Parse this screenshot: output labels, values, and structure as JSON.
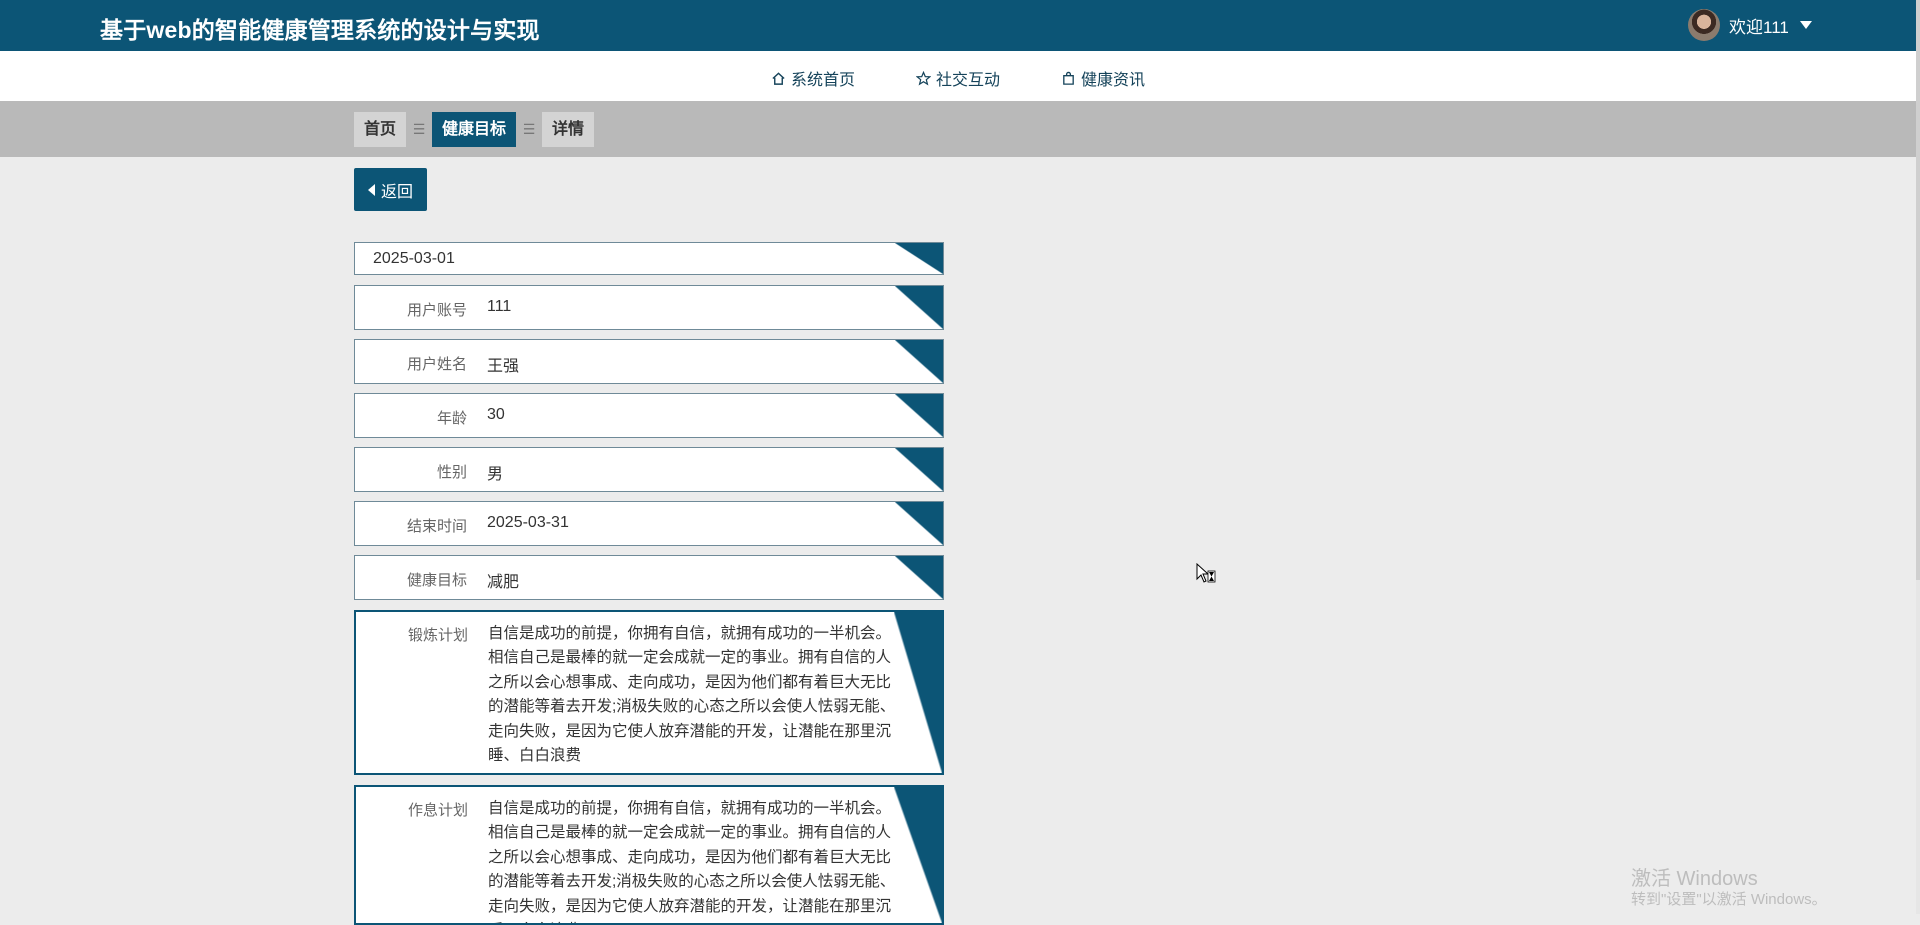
{
  "header": {
    "title": "基于web的智能健康管理系统的设计与实现",
    "user_greeting": "欢迎111"
  },
  "nav": {
    "items": [
      {
        "label": "系统首页",
        "icon": "home-icon"
      },
      {
        "label": "社交互动",
        "icon": "star-icon"
      },
      {
        "label": "健康资讯",
        "icon": "bag-icon"
      }
    ]
  },
  "breadcrumb": {
    "items": [
      "首页",
      "健康目标",
      "详情"
    ],
    "separator": "☰",
    "active_index": 1
  },
  "back_button": {
    "label": "返回"
  },
  "detail": {
    "date": "2025-03-01",
    "fields": [
      {
        "label": "用户账号",
        "value": "111"
      },
      {
        "label": "用户姓名",
        "value": "王强"
      },
      {
        "label": "年龄",
        "value": "30"
      },
      {
        "label": "性别",
        "value": "男"
      },
      {
        "label": "结束时间",
        "value": "2025-03-31"
      },
      {
        "label": "健康目标",
        "value": "减肥"
      }
    ],
    "exercise_plan": {
      "label": "锻炼计划",
      "value": "自信是成功的前提，你拥有自信，就拥有成功的一半机会。相信自己是最棒的就一定会成就一定的事业。拥有自信的人之所以会心想事成、走向成功，是因为他们都有着巨大无比的潜能等着去开发;消极失败的心态之所以会使人怯弱无能、走向失败，是因为它使人放弃潜能的开发，让潜能在那里沉睡、白白浪费"
    },
    "rest_plan": {
      "label": "作息计划",
      "value": "自信是成功的前提，你拥有自信，就拥有成功的一半机会。相信自己是最棒的就一定会成就一定的事业。拥有自信的人之所以会心想事成、走向成功，是因为他们都有着巨大无比的潜能等着去开发;消极失败的心态之所以会使人怯弱无能、走向失败，是因为它使人放弃潜能的开发，让潜能在那里沉睡、白白浪费"
    }
  },
  "watermark": {
    "line1": "激活 Windows",
    "line2": "转到\"设置\"以激活 Windows。"
  },
  "colors": {
    "primary": "#0c5576",
    "breadcrumb_bg": "#b9b9b9",
    "page_bg": "#ececec"
  }
}
